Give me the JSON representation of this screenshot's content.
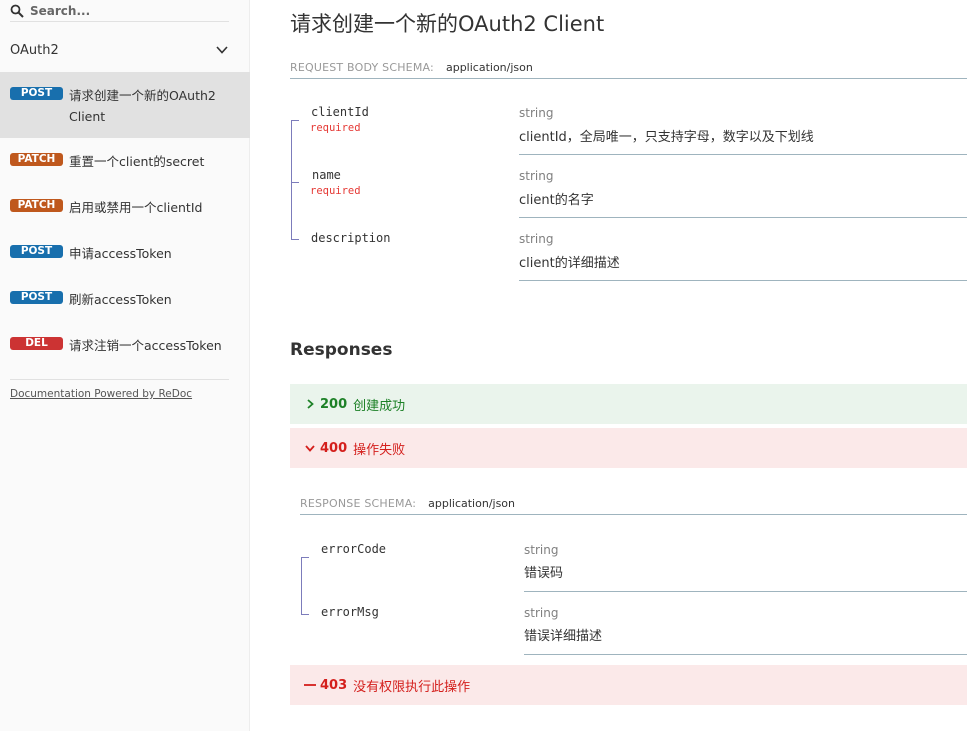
{
  "search": {
    "placeholder": "Search..."
  },
  "sidebar": {
    "group_label": "OAuth2",
    "items": [
      {
        "method": "POST",
        "label": "请求创建一个新的OAuth2 Client"
      },
      {
        "method": "PATCH",
        "label": "重置一个client的secret"
      },
      {
        "method": "PATCH",
        "label": "启用或禁用一个clientId"
      },
      {
        "method": "POST",
        "label": "申请accessToken"
      },
      {
        "method": "POST",
        "label": "刷新accessToken"
      },
      {
        "method": "DEL",
        "label": "请求注销一个accessToken"
      }
    ],
    "powered": "Documentation Powered by ReDoc"
  },
  "main": {
    "title": "请求创建一个新的OAuth2 Client",
    "request_schema": {
      "label": "REQUEST BODY SCHEMA:",
      "content_type": "application/json",
      "props": [
        {
          "name": "clientId",
          "required": "required",
          "type": "string",
          "desc": "clientId，全局唯一，只支持字母，数字以及下划线"
        },
        {
          "name": "name",
          "required": "required",
          "type": "string",
          "desc": "client的名字"
        },
        {
          "name": "description",
          "required": "",
          "type": "string",
          "desc": "client的详细描述"
        }
      ]
    },
    "responses_title": "Responses",
    "responses": [
      {
        "code": "200",
        "desc": "创建成功"
      },
      {
        "code": "400",
        "desc": "操作失败"
      },
      {
        "code": "403",
        "desc": "没有权限执行此操作"
      }
    ],
    "response_schema": {
      "label": "RESPONSE SCHEMA:",
      "content_type": "application/json",
      "props": [
        {
          "name": "errorCode",
          "type": "string",
          "desc": "错误码"
        },
        {
          "name": "errorMsg",
          "type": "string",
          "desc": "错误详细描述"
        }
      ]
    }
  },
  "colors": {
    "post": "#186fad",
    "patch": "#bf581d",
    "delete": "#cc3333",
    "success": "#1d8127",
    "error": "#d41f1c",
    "active_item": "#e1e1e1"
  }
}
